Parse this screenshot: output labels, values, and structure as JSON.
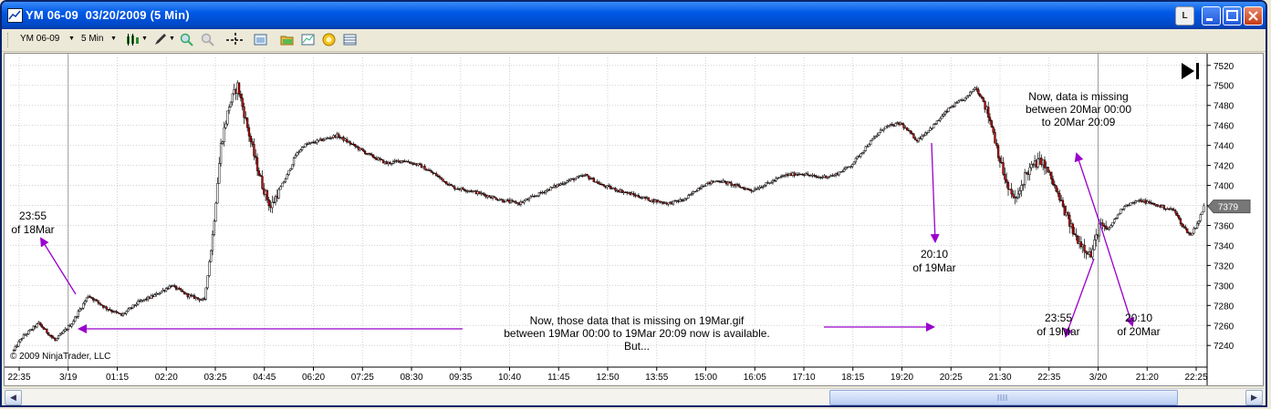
{
  "window": {
    "title": "YM 06-09  03/20/2009 (5 Min)",
    "button_l": "L",
    "minimize_icon": "minimize-icon",
    "maximize_icon": "maximize-icon",
    "close_icon": "close-icon"
  },
  "toolbar": {
    "instrument": "YM 06-09",
    "interval": "5 Min"
  },
  "chart": {
    "copyright": "© 2009 NinjaTrader, LLC",
    "last_price_label": "7379",
    "annotations": {
      "a1_line1": "23:55",
      "a1_line2": "of 18Mar",
      "a2_line1": "20:10",
      "a2_line2": "of 19Mar",
      "a3_line1": "Now, data is missing",
      "a3_line2": "between 20Mar 00:00",
      "a3_line3": "to 20Mar 20:09",
      "a4_line1": "23:55",
      "a4_line2": "of 19Mar",
      "a5_line1": "20:10",
      "a5_line2": "of 20Mar",
      "bottom_line1": "Now, those data that is missing on 19Mar.gif",
      "bottom_line2": "between 19Mar 00:00 to 19Mar 20:09 now is available.",
      "bottom_line3": "But..."
    },
    "colors": {
      "up": "#ffffff",
      "down": "#cc0000",
      "annotation": "#9900cc",
      "grid": "#d0d0d0"
    }
  },
  "chart_data": {
    "type": "candlestick",
    "xlabels": [
      "22:35",
      "3/19",
      "01:15",
      "02:20",
      "03:25",
      "04:45",
      "06:20",
      "07:25",
      "08:30",
      "09:35",
      "10:40",
      "11:45",
      "12:50",
      "13:55",
      "15:00",
      "16:05",
      "17:10",
      "18:15",
      "19:20",
      "20:25",
      "21:30",
      "22:35",
      "3/20",
      "21:20",
      "22:25"
    ],
    "yticks": [
      7240,
      7260,
      7280,
      7300,
      7320,
      7340,
      7360,
      7380,
      7400,
      7420,
      7440,
      7460,
      7480,
      7500,
      7520
    ],
    "ylim": [
      7222,
      7528
    ],
    "anchors": [
      [
        0,
        7235
      ],
      [
        5,
        7248
      ],
      [
        15,
        7262
      ],
      [
        25,
        7245
      ],
      [
        35,
        7262
      ],
      [
        45,
        7290
      ],
      [
        55,
        7278
      ],
      [
        65,
        7270
      ],
      [
        75,
        7283
      ],
      [
        85,
        7290
      ],
      [
        95,
        7300
      ],
      [
        105,
        7290
      ],
      [
        115,
        7285
      ],
      [
        120,
        7350
      ],
      [
        125,
        7440
      ],
      [
        130,
        7480
      ],
      [
        135,
        7500
      ],
      [
        140,
        7465
      ],
      [
        145,
        7430
      ],
      [
        150,
        7400
      ],
      [
        155,
        7378
      ],
      [
        160,
        7395
      ],
      [
        165,
        7410
      ],
      [
        170,
        7430
      ],
      [
        175,
        7440
      ],
      [
        185,
        7445
      ],
      [
        195,
        7450
      ],
      [
        205,
        7440
      ],
      [
        215,
        7430
      ],
      [
        225,
        7422
      ],
      [
        235,
        7425
      ],
      [
        245,
        7420
      ],
      [
        255,
        7410
      ],
      [
        265,
        7398
      ],
      [
        275,
        7395
      ],
      [
        285,
        7390
      ],
      [
        295,
        7385
      ],
      [
        305,
        7382
      ],
      [
        315,
        7390
      ],
      [
        325,
        7398
      ],
      [
        335,
        7405
      ],
      [
        345,
        7410
      ],
      [
        355,
        7400
      ],
      [
        365,
        7395
      ],
      [
        375,
        7390
      ],
      [
        385,
        7385
      ],
      [
        395,
        7382
      ],
      [
        405,
        7386
      ],
      [
        415,
        7400
      ],
      [
        425,
        7405
      ],
      [
        435,
        7400
      ],
      [
        445,
        7395
      ],
      [
        455,
        7402
      ],
      [
        465,
        7410
      ],
      [
        475,
        7412
      ],
      [
        485,
        7408
      ],
      [
        495,
        7410
      ],
      [
        505,
        7420
      ],
      [
        515,
        7440
      ],
      [
        525,
        7458
      ],
      [
        535,
        7462
      ],
      [
        545,
        7445
      ],
      [
        555,
        7460
      ],
      [
        565,
        7478
      ],
      [
        575,
        7488
      ],
      [
        580,
        7498
      ],
      [
        585,
        7485
      ],
      [
        590,
        7460
      ],
      [
        595,
        7425
      ],
      [
        600,
        7395
      ],
      [
        605,
        7385
      ],
      [
        610,
        7410
      ],
      [
        615,
        7420
      ],
      [
        620,
        7425
      ],
      [
        625,
        7410
      ],
      [
        630,
        7390
      ],
      [
        635,
        7370
      ],
      [
        640,
        7350
      ],
      [
        645,
        7340
      ],
      [
        650,
        7330
      ],
      [
        655,
        7360
      ],
      [
        660,
        7355
      ],
      [
        665,
        7368
      ],
      [
        670,
        7380
      ],
      [
        680,
        7385
      ],
      [
        690,
        7380
      ],
      [
        700,
        7375
      ],
      [
        705,
        7360
      ],
      [
        710,
        7350
      ],
      [
        715,
        7365
      ],
      [
        718,
        7379
      ]
    ],
    "last_price": 7379
  }
}
